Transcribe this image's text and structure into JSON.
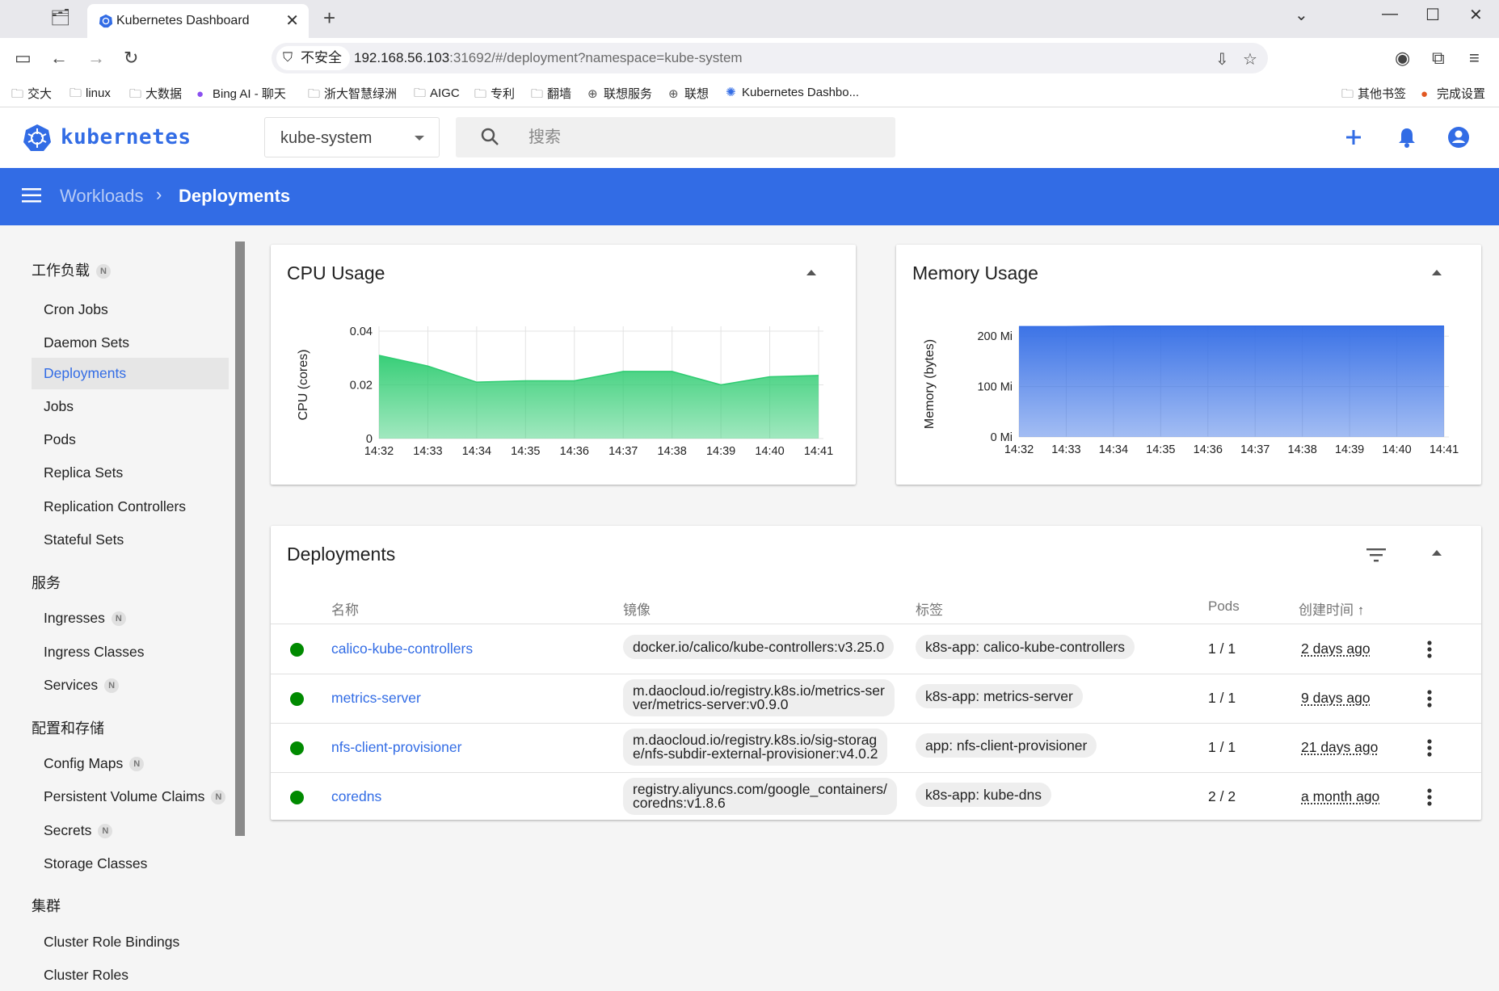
{
  "browser": {
    "tab_title": "Kubernetes Dashboard",
    "security_label": "不安全",
    "url_host": "192.168.56.103",
    "url_rest": ":31692/#/deployment?namespace=kube-system",
    "bookmarks": [
      "交大",
      "linux",
      "大数据",
      "Bing AI - 聊天",
      "浙大智慧绿洲",
      "AIGC",
      "专利",
      "翻墙",
      "联想服务",
      "联想",
      "Kubernetes Dashbo..."
    ],
    "bookmarks_right": [
      "其他书签",
      "完成设置"
    ]
  },
  "header": {
    "logo_text": "kubernetes",
    "namespace": "kube-system",
    "search_placeholder": "搜索"
  },
  "breadcrumb": {
    "parent": "Workloads",
    "separator": "›",
    "current": "Deployments"
  },
  "sidebar": {
    "sections": [
      {
        "title": "工作负载",
        "badge": "N",
        "items": [
          {
            "label": "Cron Jobs"
          },
          {
            "label": "Daemon Sets"
          },
          {
            "label": "Deployments",
            "active": true
          },
          {
            "label": "Jobs"
          },
          {
            "label": "Pods"
          },
          {
            "label": "Replica Sets"
          },
          {
            "label": "Replication Controllers"
          },
          {
            "label": "Stateful Sets"
          }
        ]
      },
      {
        "title": "服务",
        "items": [
          {
            "label": "Ingresses",
            "badge": "N"
          },
          {
            "label": "Ingress Classes"
          },
          {
            "label": "Services",
            "badge": "N"
          }
        ]
      },
      {
        "title": "配置和存储",
        "items": [
          {
            "label": "Config Maps",
            "badge": "N"
          },
          {
            "label": "Persistent Volume Claims",
            "badge": "N"
          },
          {
            "label": "Secrets",
            "badge": "N"
          },
          {
            "label": "Storage Classes"
          }
        ]
      },
      {
        "title": "集群",
        "items": [
          {
            "label": "Cluster Role Bindings"
          },
          {
            "label": "Cluster Roles"
          }
        ]
      }
    ]
  },
  "cpu_card": {
    "title": "CPU Usage"
  },
  "memory_card": {
    "title": "Memory Usage"
  },
  "chart_data": [
    {
      "type": "area",
      "title": "CPU Usage",
      "ylabel": "CPU (cores)",
      "x": [
        "14:32",
        "14:33",
        "14:34",
        "14:35",
        "14:36",
        "14:37",
        "14:38",
        "14:39",
        "14:40",
        "14:41"
      ],
      "y_ticks": [
        "0",
        "0.02",
        "0.04"
      ],
      "ylim": [
        0,
        0.04
      ],
      "values": [
        0.031,
        0.027,
        0.021,
        0.0215,
        0.0215,
        0.025,
        0.025,
        0.02,
        0.023,
        0.0235
      ],
      "color": "#2ecc71"
    },
    {
      "type": "area",
      "title": "Memory Usage",
      "ylabel": "Memory (bytes)",
      "x": [
        "14:32",
        "14:33",
        "14:34",
        "14:35",
        "14:36",
        "14:37",
        "14:38",
        "14:39",
        "14:40",
        "14:41"
      ],
      "y_ticks": [
        "0 Mi",
        "100 Mi",
        "200 Mi"
      ],
      "ylim": [
        0,
        210
      ],
      "values": [
        219,
        219,
        220,
        220,
        220,
        220,
        220,
        220,
        220,
        220
      ],
      "color": "#326ce5"
    }
  ],
  "deployments": {
    "title": "Deployments",
    "columns": {
      "name": "名称",
      "image": "镜像",
      "labels": "标签",
      "pods": "Pods",
      "created": "创建时间"
    },
    "rows": [
      {
        "name": "calico-kube-controllers",
        "image": "docker.io/calico/kube-controllers:v3.25.0",
        "label": "k8s-app: calico-kube-controllers",
        "pods": "1 / 1",
        "age": "2 days ago"
      },
      {
        "name": "metrics-server",
        "image": "m.daocloud.io/registry.k8s.io/metrics-ser\nver/metrics-server:v0.9.0",
        "label": "k8s-app: metrics-server",
        "pods": "1 / 1",
        "age": "9 days ago"
      },
      {
        "name": "nfs-client-provisioner",
        "image": "m.daocloud.io/registry.k8s.io/sig-storag\ne/nfs-subdir-external-provisioner:v4.0.2",
        "label": "app: nfs-client-provisioner",
        "pods": "1 / 1",
        "age": "21 days ago"
      },
      {
        "name": "coredns",
        "image": "registry.aliyuncs.com/google_containers/\ncoredns:v1.8.6",
        "label": "k8s-app: kube-dns",
        "pods": "2 / 2",
        "age": "a month ago"
      }
    ]
  }
}
